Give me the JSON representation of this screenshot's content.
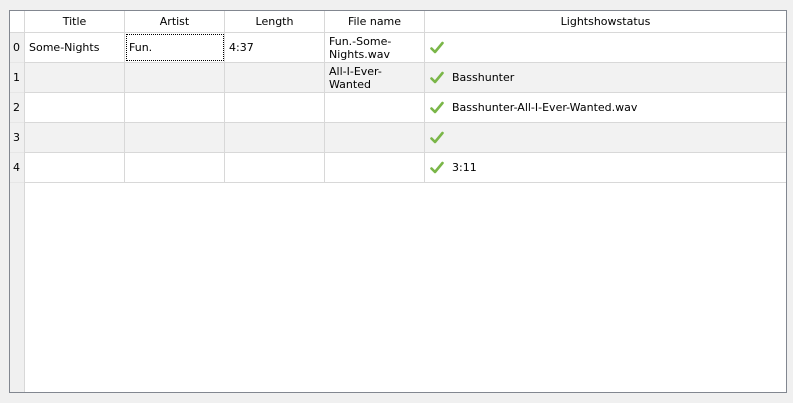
{
  "table": {
    "columns": [
      "Title",
      "Artist",
      "Length",
      "File name",
      "Lightshowstatus"
    ],
    "row_headers": [
      "0",
      "1",
      "2",
      "3",
      "4"
    ],
    "rows": [
      {
        "title": "Some-Nights",
        "artist": "Fun.",
        "length": "4:37",
        "file_name": "Fun.-Some-Nights.wav",
        "status_text": ""
      },
      {
        "title": "",
        "artist": "",
        "length": "",
        "file_name": "All-I-Ever-Wanted",
        "status_text": "Basshunter"
      },
      {
        "title": "",
        "artist": "",
        "length": "",
        "file_name": "",
        "status_text": "Basshunter-All-I-Ever-Wanted.wav"
      },
      {
        "title": "",
        "artist": "",
        "length": "",
        "file_name": "",
        "status_text": ""
      },
      {
        "title": "",
        "artist": "",
        "length": "",
        "file_name": "",
        "status_text": "3:11"
      }
    ],
    "status_icon": "checkmark-icon",
    "check_color": "#7ab648"
  }
}
